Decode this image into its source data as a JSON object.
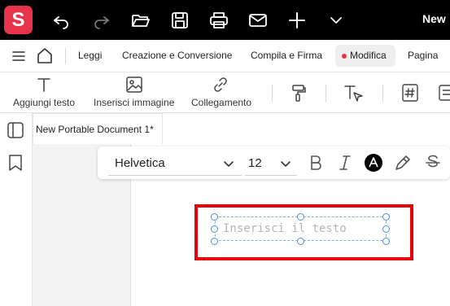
{
  "titlebar": {
    "logo_letter": "S",
    "new_label": "New",
    "icons": [
      "undo-icon",
      "redo-icon",
      "open-folder-icon",
      "save-icon",
      "print-icon",
      "mail-icon",
      "plus-icon",
      "chevron-down-icon"
    ]
  },
  "menubar": {
    "items": [
      "Leggi",
      "Creazione e Conversione",
      "Compila e Firma",
      "Modifica",
      "Pagina"
    ],
    "active": "Modifica"
  },
  "tools": {
    "add_text": "Aggiungi testo",
    "insert_image": "Inserisci immagine",
    "link": "Collegamento"
  },
  "document": {
    "tab_title": "New Portable Document 1*"
  },
  "fontbar": {
    "font_family": "Helvetica",
    "font_size": "12",
    "text_color": "#000000"
  },
  "textbox": {
    "placeholder": "Inserisci il testo"
  },
  "colors": {
    "accent": "#e8344a",
    "highlight": "#e8000b",
    "selection": "#4a8fd4"
  }
}
